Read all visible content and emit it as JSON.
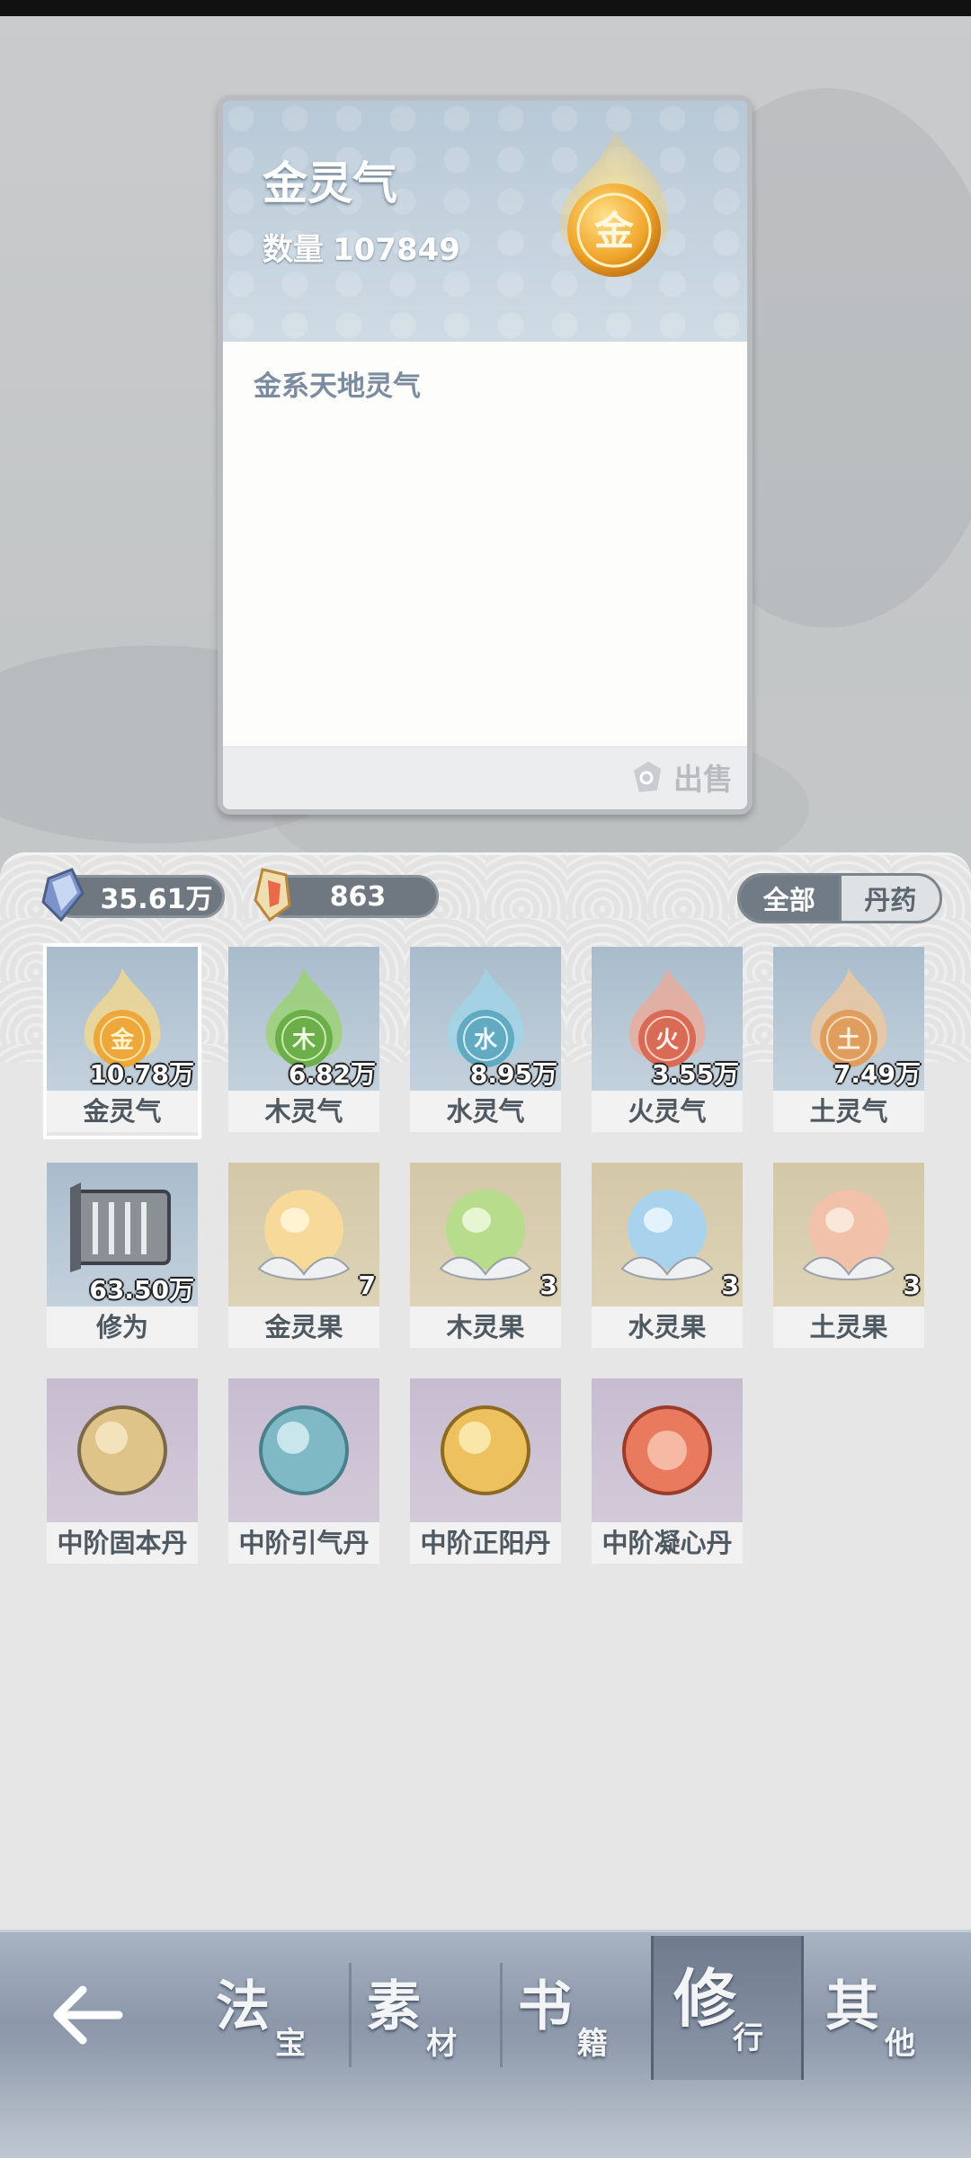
{
  "detail": {
    "title": "金灵气",
    "quantity_label": "数量",
    "quantity_value": "107849",
    "description": "金系天地灵气",
    "sell_label": "出售",
    "orb_char": "金"
  },
  "currencies": {
    "spirit_stone": "35.61万",
    "gem": "863"
  },
  "filters": [
    {
      "label": "全部",
      "active": true
    },
    {
      "label": "丹药",
      "active": false
    }
  ],
  "items": [
    {
      "name": "金灵气",
      "count": "10.78万",
      "char": "金"
    },
    {
      "name": "木灵气",
      "count": "6.82万",
      "char": "木"
    },
    {
      "name": "水灵气",
      "count": "8.95万",
      "char": "水"
    },
    {
      "name": "火灵气",
      "count": "3.55万",
      "char": "火"
    },
    {
      "name": "土灵气",
      "count": "7.49万",
      "char": "土"
    },
    {
      "name": "修为",
      "count": "63.50万"
    },
    {
      "name": "金灵果",
      "count": "7"
    },
    {
      "name": "木灵果",
      "count": "3"
    },
    {
      "name": "水灵果",
      "count": "3"
    },
    {
      "name": "土灵果",
      "count": "3"
    },
    {
      "name": "中阶固本丹"
    },
    {
      "name": "中阶引气丹"
    },
    {
      "name": "中阶正阳丹"
    },
    {
      "name": "中阶凝心丹"
    }
  ],
  "nav": [
    {
      "big": "法",
      "small": "宝",
      "active": false
    },
    {
      "big": "素",
      "small": "材",
      "active": false
    },
    {
      "big": "书",
      "small": "籍",
      "active": false
    },
    {
      "big": "修",
      "small": "行",
      "active": true
    },
    {
      "big": "其",
      "small": "他",
      "active": false
    }
  ],
  "colors": {
    "gold": "#f0b63a",
    "wood": "#7fc45a",
    "water": "#6fb7cf",
    "fire": "#e07a62",
    "earth": "#e3a76a"
  }
}
